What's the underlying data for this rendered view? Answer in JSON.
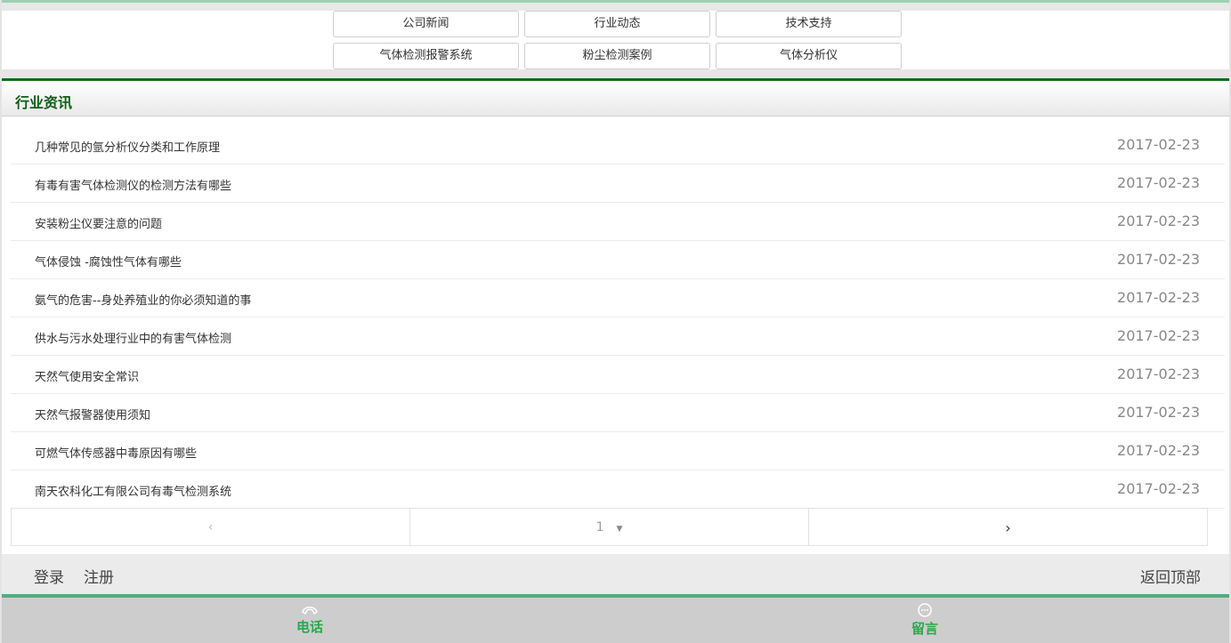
{
  "nav": {
    "items": [
      {
        "label": "公司新闻"
      },
      {
        "label": "行业动态"
      },
      {
        "label": "技术支持"
      },
      {
        "label": "气体检测报警系统"
      },
      {
        "label": "粉尘检测案例"
      },
      {
        "label": "气体分析仪"
      }
    ]
  },
  "section": {
    "title": "行业资讯"
  },
  "news": [
    {
      "title": "几种常见的氩分析仪分类和工作原理",
      "date": "2017-02-23"
    },
    {
      "title": "有毒有害气体检测仪的检测方法有哪些",
      "date": "2017-02-23"
    },
    {
      "title": "安装粉尘仪要注意的问题",
      "date": "2017-02-23"
    },
    {
      "title": "气体侵蚀 -腐蚀性气体有哪些",
      "date": "2017-02-23"
    },
    {
      "title": "氨气的危害--身处养殖业的你必须知道的事",
      "date": "2017-02-23"
    },
    {
      "title": "供水与污水处理行业中的有害气体检测",
      "date": "2017-02-23"
    },
    {
      "title": "天然气使用安全常识",
      "date": "2017-02-23"
    },
    {
      "title": "天然气报警器使用须知",
      "date": "2017-02-23"
    },
    {
      "title": "可燃气体传感器中毒原因有哪些",
      "date": "2017-02-23"
    },
    {
      "title": "南天农科化工有限公司有毒气检测系统",
      "date": "2017-02-23"
    }
  ],
  "pager": {
    "prev": "‹",
    "page": "1",
    "caret": "▼",
    "next": "›"
  },
  "footer": {
    "login": "登录",
    "register": "注册",
    "back_top": "返回顶部"
  },
  "tabs": {
    "phone": "电话",
    "message": "留言"
  },
  "colors": {
    "accent_green": "#0f6e16",
    "tab_green": "#2aa84a",
    "tab_border": "#4fae7f"
  }
}
